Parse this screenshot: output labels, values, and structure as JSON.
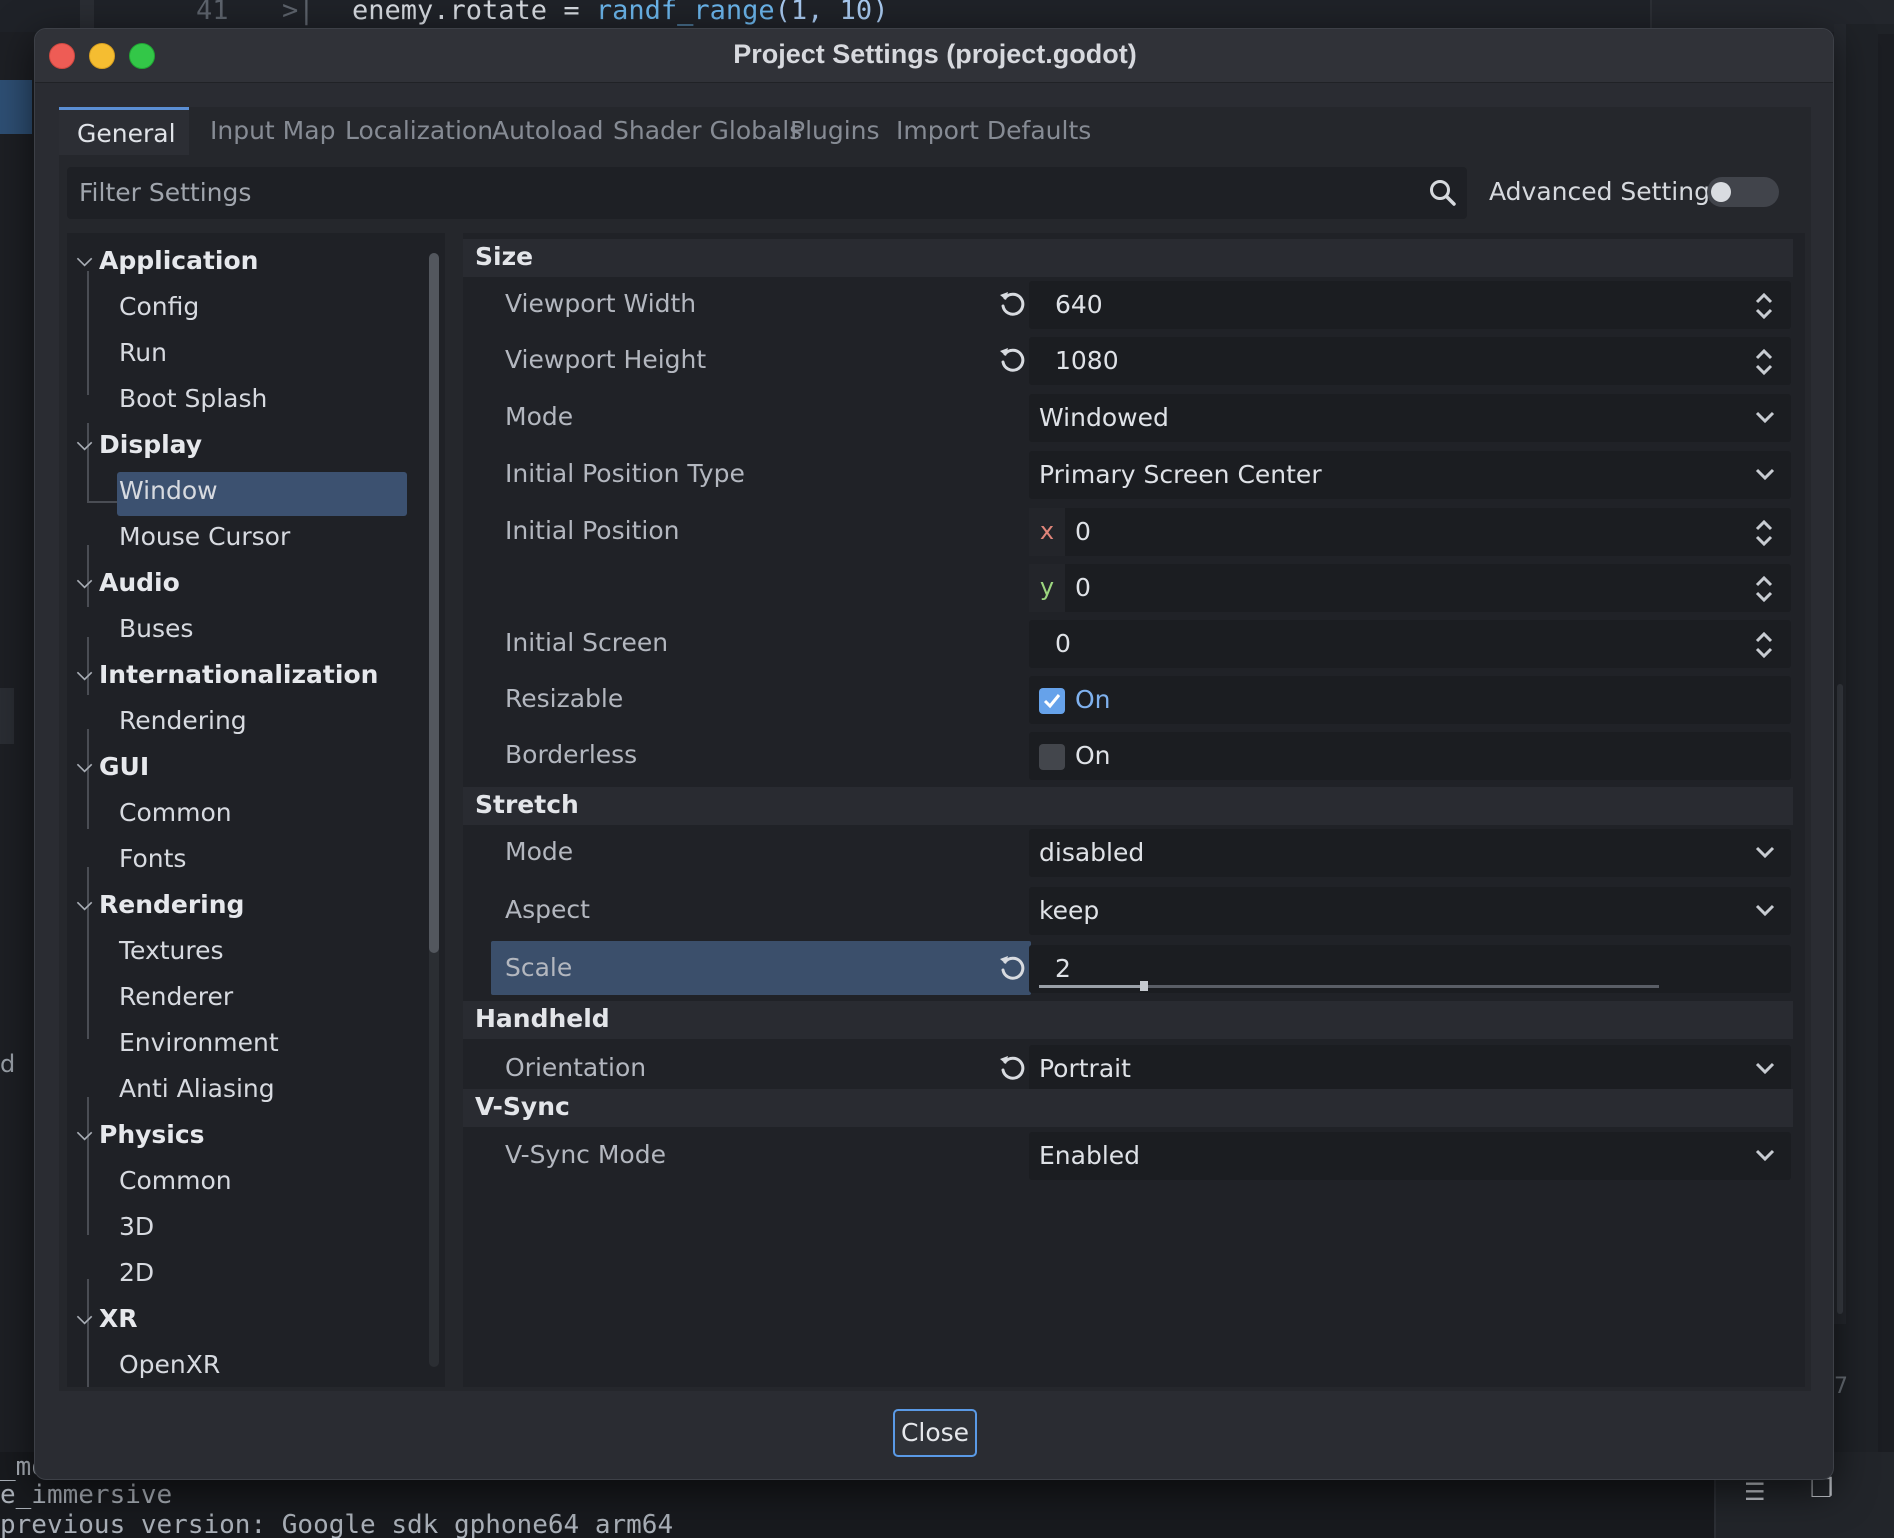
{
  "background": {
    "code_line_number": "41",
    "code_arrow": ">|",
    "code_text_prefix": "enemy.rotate = ",
    "code_text_fn": "randf_range",
    "code_text_args": "(1, 10)",
    "left_fragment": "d",
    "right_fragment": "7",
    "terminal_lines": [
      "_mo",
      "e_immersive",
      "previous version: Google sdk_gphone64_arm64"
    ]
  },
  "window": {
    "title": "Project Settings (project.godot)",
    "traffic_lights": [
      "close",
      "minimize",
      "maximize"
    ]
  },
  "tabs": [
    {
      "label": "General",
      "active": true
    },
    {
      "label": "Input Map",
      "active": false
    },
    {
      "label": "Localization",
      "active": false
    },
    {
      "label": "Autoload",
      "active": false
    },
    {
      "label": "Shader Globals",
      "active": false
    },
    {
      "label": "Plugins",
      "active": false
    },
    {
      "label": "Import Defaults",
      "active": false
    }
  ],
  "filter": {
    "placeholder": "Filter Settings",
    "advanced_label": "Advanced Settings",
    "advanced_on": false
  },
  "tree": [
    {
      "label": "Application",
      "type": "category"
    },
    {
      "label": "Config",
      "type": "leaf"
    },
    {
      "label": "Run",
      "type": "leaf"
    },
    {
      "label": "Boot Splash",
      "type": "leaf"
    },
    {
      "label": "Display",
      "type": "category"
    },
    {
      "label": "Window",
      "type": "leaf",
      "selected": true
    },
    {
      "label": "Mouse Cursor",
      "type": "leaf"
    },
    {
      "label": "Audio",
      "type": "category"
    },
    {
      "label": "Buses",
      "type": "leaf"
    },
    {
      "label": "Internationalization",
      "type": "category"
    },
    {
      "label": "Rendering",
      "type": "leaf"
    },
    {
      "label": "GUI",
      "type": "category"
    },
    {
      "label": "Common",
      "type": "leaf"
    },
    {
      "label": "Fonts",
      "type": "leaf"
    },
    {
      "label": "Rendering",
      "type": "category"
    },
    {
      "label": "Textures",
      "type": "leaf"
    },
    {
      "label": "Renderer",
      "type": "leaf"
    },
    {
      "label": "Environment",
      "type": "leaf"
    },
    {
      "label": "Anti Aliasing",
      "type": "leaf"
    },
    {
      "label": "Physics",
      "type": "category"
    },
    {
      "label": "Common",
      "type": "leaf"
    },
    {
      "label": "3D",
      "type": "leaf"
    },
    {
      "label": "2D",
      "type": "leaf"
    },
    {
      "label": "XR",
      "type": "category"
    },
    {
      "label": "OpenXR",
      "type": "leaf"
    }
  ],
  "sections": {
    "size": {
      "title": "Size",
      "viewport_width": {
        "label": "Viewport Width",
        "value": "640"
      },
      "viewport_height": {
        "label": "Viewport Height",
        "value": "1080"
      },
      "mode": {
        "label": "Mode",
        "value": "Windowed"
      },
      "initial_position_type": {
        "label": "Initial Position Type",
        "value": "Primary Screen Center"
      },
      "initial_position": {
        "label": "Initial Position",
        "x_axis": "x",
        "x": "0",
        "y_axis": "y",
        "y": "0"
      },
      "initial_screen": {
        "label": "Initial Screen",
        "value": "0"
      },
      "resizable": {
        "label": "Resizable",
        "checked": true,
        "text": "On"
      },
      "borderless": {
        "label": "Borderless",
        "checked": false,
        "text": "On"
      }
    },
    "stretch": {
      "title": "Stretch",
      "mode": {
        "label": "Mode",
        "value": "disabled"
      },
      "aspect": {
        "label": "Aspect",
        "value": "keep"
      },
      "scale": {
        "label": "Scale",
        "value": "2",
        "slider_fraction": 0.17
      }
    },
    "handheld": {
      "title": "Handheld",
      "orientation": {
        "label": "Orientation",
        "value": "Portrait"
      }
    },
    "vsync": {
      "title": "V-Sync",
      "vsync_mode": {
        "label": "V-Sync Mode",
        "value": "Enabled"
      }
    }
  },
  "footer": {
    "close_label": "Close"
  },
  "colors": {
    "accent": "#5b8fd4",
    "selection": "#3c5170",
    "checkbox_on": "#66a2ea",
    "axis_x": "#e0857a",
    "axis_y": "#9cd67f"
  }
}
